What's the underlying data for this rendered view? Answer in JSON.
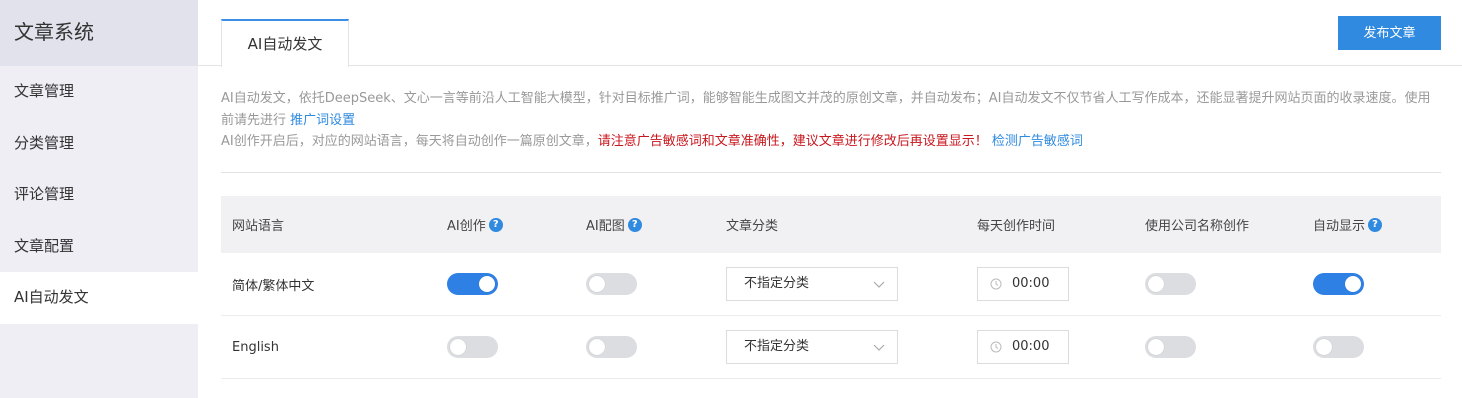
{
  "sidebar": {
    "title": "文章系统",
    "items": [
      {
        "label": "文章管理"
      },
      {
        "label": "分类管理"
      },
      {
        "label": "评论管理"
      },
      {
        "label": "文章配置"
      },
      {
        "label": "AI自动发文"
      }
    ]
  },
  "header": {
    "tab_label": "AI自动发文",
    "publish_label": "发布文章"
  },
  "description": {
    "line1": "AI自动发文，依托DeepSeek、文心一言等前沿人工智能大模型，针对目标推广词，能够智能生成图文并茂的原创文章，并自动发布；AI自动发文不仅节省人工写作成本，还能显著提升网站页面的收录速度。使用前请先进行",
    "link1": "推广词设置",
    "line2": "AI创作开启后，对应的网站语言，每天将自动创作一篇原创文章，",
    "warning": "请注意广告敏感词和文章准确性，建议文章进行修改后再设置显示！",
    "link2": "检测广告敏感词"
  },
  "table": {
    "headers": {
      "language": "网站语言",
      "ai_create": "AI创作",
      "ai_image": "AI配图",
      "category": "文章分类",
      "daily_time": "每天创作时间",
      "company_name": "使用公司名称创作",
      "auto_display": "自动显示"
    },
    "help_glyph": "?",
    "rows": [
      {
        "language": "简体/繁体中文",
        "ai_create": true,
        "ai_image": false,
        "category": "不指定分类",
        "time": "00:00",
        "company_name": false,
        "auto_display": true
      },
      {
        "language": "English",
        "ai_create": false,
        "ai_image": false,
        "category": "不指定分类",
        "time": "00:00",
        "company_name": false,
        "auto_display": false
      }
    ]
  },
  "colors": {
    "accent": "#2f8ae0",
    "warning": "#c8161d",
    "sidebar_bg": "#eeeef4"
  },
  "icons": {
    "help": "question-circle-icon",
    "dropdown": "chevron-down-icon",
    "time": "clock-icon"
  }
}
